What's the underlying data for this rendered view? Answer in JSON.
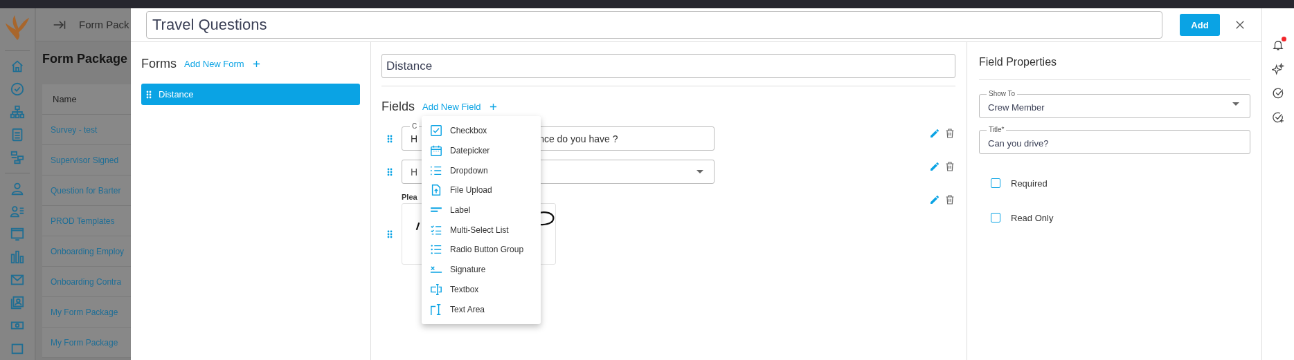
{
  "background_page": {
    "header_title": "Form Pack",
    "page_title": "Form Package",
    "table": {
      "columns": [
        "Name"
      ],
      "rows": [
        "Survey - test",
        "Supervisor Signed",
        "Question for Barter",
        "PROD Templates",
        "Onboarding Employ",
        "Onboarding Contra",
        "My Form Package",
        "My Form Package"
      ]
    }
  },
  "modal": {
    "title_value": "Travel Questions",
    "add_button": "Add",
    "forms": {
      "heading": "Forms",
      "add_link": "Add New Form",
      "items": [
        {
          "label": "Distance",
          "selected": true
        }
      ]
    },
    "editor": {
      "form_name": "Distance",
      "fields_heading": "Fields",
      "add_link": "Add New Field",
      "fields": [
        {
          "kind": "text",
          "label": "C",
          "value_start": "H",
          "value_end": "nce do you have ?"
        },
        {
          "kind": "dropdown",
          "placeholder": "H"
        },
        {
          "kind": "signature",
          "label": "Plea"
        }
      ],
      "field_type_menu": [
        {
          "kind": "checkbox",
          "label": "Checkbox"
        },
        {
          "kind": "datepicker",
          "label": "Datepicker"
        },
        {
          "kind": "dropdown",
          "label": "Dropdown"
        },
        {
          "kind": "file",
          "label": "File Upload"
        },
        {
          "kind": "label",
          "label": "Label"
        },
        {
          "kind": "multiselect",
          "label": "Multi-Select List"
        },
        {
          "kind": "radio",
          "label": "Radio Button Group"
        },
        {
          "kind": "signature",
          "label": "Signature"
        },
        {
          "kind": "textbox",
          "label": "Textbox"
        },
        {
          "kind": "textarea",
          "label": "Text Area"
        }
      ]
    },
    "properties": {
      "heading": "Field Properties",
      "show_to": {
        "label": "Show To",
        "value": "Crew Member"
      },
      "title": {
        "label": "Title*",
        "value": "Can you drive?"
      },
      "options": [
        {
          "label": "Required",
          "checked": false
        },
        {
          "label": "Read Only",
          "checked": false
        }
      ]
    }
  },
  "rail": {
    "has_notification": true
  }
}
